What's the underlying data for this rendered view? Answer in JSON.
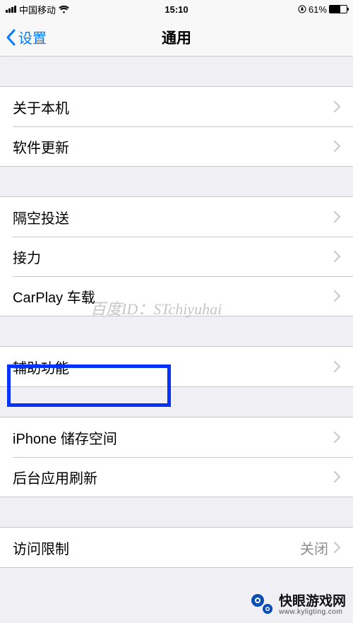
{
  "status": {
    "carrier": "中国移动",
    "time": "15:10",
    "battery_pct": "61%"
  },
  "nav": {
    "back_label": "设置",
    "title": "通用"
  },
  "sections": [
    {
      "items": [
        {
          "label": "关于本机"
        },
        {
          "label": "软件更新"
        }
      ]
    },
    {
      "items": [
        {
          "label": "隔空投送"
        },
        {
          "label": "接力"
        },
        {
          "label": "CarPlay 车载"
        }
      ]
    },
    {
      "items": [
        {
          "label": "辅助功能"
        }
      ]
    },
    {
      "items": [
        {
          "label": "iPhone 储存空间"
        },
        {
          "label": "后台应用刷新"
        }
      ]
    },
    {
      "items": [
        {
          "label": "访问限制",
          "value": "关闭"
        }
      ]
    }
  ],
  "watermark": {
    "text1": "百度ID：STchiyuhai",
    "brand": "快眼游戏网",
    "url": "www.kyligting.com"
  }
}
